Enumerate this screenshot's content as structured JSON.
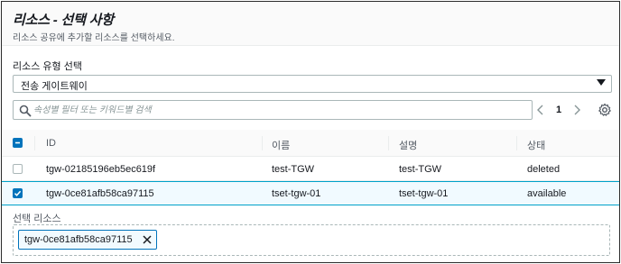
{
  "header": {
    "title": "리소스 - 선택 사항",
    "description": "리소스 공유에 추가할 리소스를 선택하세요."
  },
  "resource_type": {
    "label": "리소스 유형 선택",
    "value": "전송 게이트웨이"
  },
  "search": {
    "placeholder": "속성별 필터 또는 키워드별 검색",
    "value": ""
  },
  "pagination": {
    "current_page": "1"
  },
  "table": {
    "columns": [
      "ID",
      "이름",
      "설명",
      "상태"
    ],
    "header_checkbox": "indeterminate",
    "rows": [
      {
        "checked": false,
        "id": "tgw-02185196eb5ec619f",
        "name": "test-TGW",
        "description": "test-TGW",
        "status": "deleted"
      },
      {
        "checked": true,
        "id": "tgw-0ce81afb58ca97115",
        "name": "tset-tgw-01",
        "description": "tset-tgw-01",
        "status": "available"
      }
    ]
  },
  "selected_resources": {
    "label": "선택 리소스",
    "tokens": [
      "tgw-0ce81afb58ca97115"
    ]
  },
  "colors": {
    "accent": "#0073bb",
    "selected_row_bg": "#f1faff",
    "selected_row_border": "#00a1c9",
    "text_primary": "#16191f",
    "text_secondary": "#545b64"
  }
}
